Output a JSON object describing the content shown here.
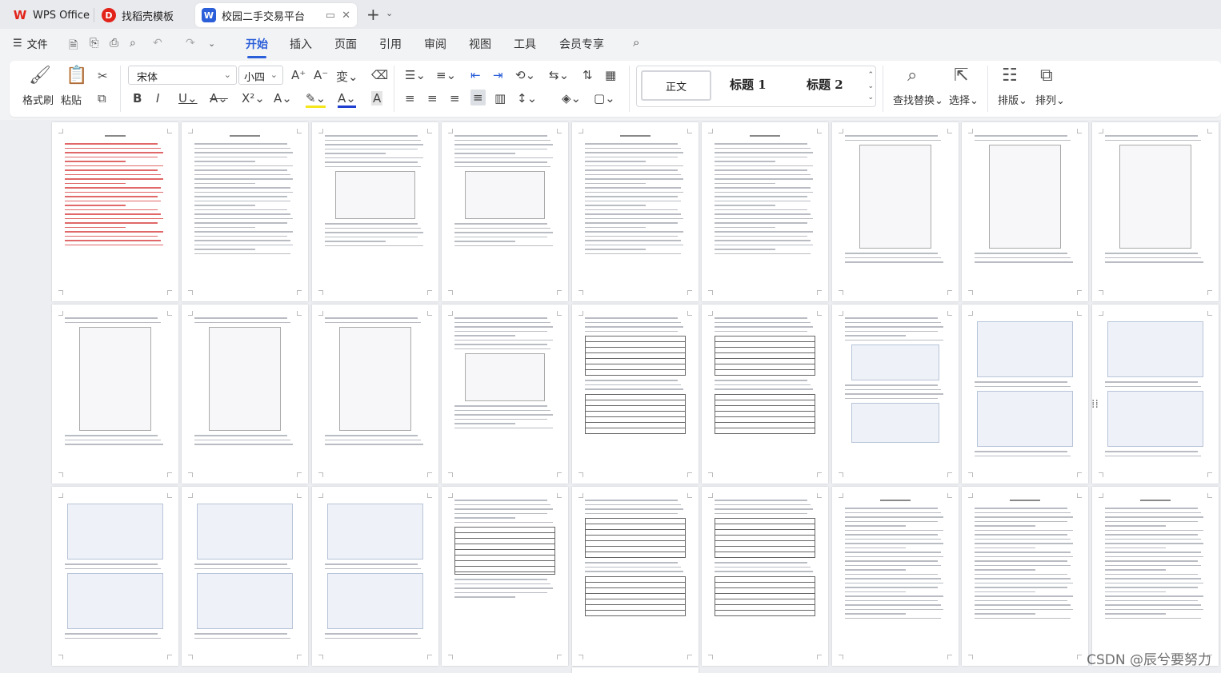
{
  "tabs": [
    {
      "label": "WPS Office",
      "icon": "wps-logo-icon"
    },
    {
      "label": "找稻壳模板",
      "icon": "docer-icon"
    },
    {
      "label": "校园二手交易平台",
      "icon": "word-doc-icon"
    }
  ],
  "menu": {
    "file_label": "文件",
    "tabs": [
      "开始",
      "插入",
      "页面",
      "引用",
      "审阅",
      "视图",
      "工具",
      "会员专享"
    ],
    "active_tab": "开始"
  },
  "ribbon": {
    "format_painter": "格式刷",
    "paste": "粘贴",
    "font_name": "宋体",
    "font_size": "小四",
    "styles": {
      "normal": "正文",
      "h1": "标题 1",
      "h2": "标题 2"
    },
    "find_replace": "查找替换",
    "select": "选择",
    "layout": "排版",
    "arrange": "排列"
  },
  "watermark": "CSDN @辰兮要努力",
  "colors": {
    "accent": "#2b5fd9",
    "wps_red": "#e2231a",
    "highlight": "#f5e51b",
    "font_color": "#1f3fd1"
  }
}
